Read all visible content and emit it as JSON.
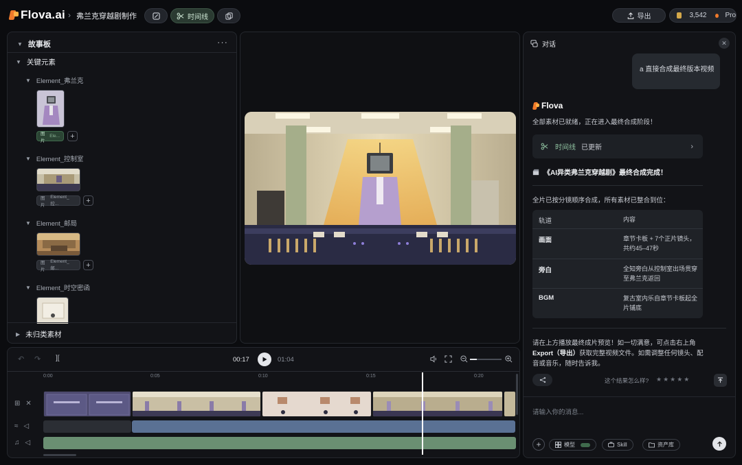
{
  "app": {
    "logo_text": "Flova.ai",
    "project_name": "弗兰克穿越剧制作",
    "crumb_sep": "›"
  },
  "toolbar": {
    "timeline_label": "时间线",
    "export_label": "导出",
    "credits": "3,542",
    "plan": "Pro"
  },
  "storyboard": {
    "title": "故事板",
    "more": "···",
    "key_elements_label": "关键元素",
    "elements": [
      {
        "name": "Element_弗兰克",
        "tag": "图片",
        "tag_sub": "Ele..."
      },
      {
        "name": "Element_控制室",
        "tag": "图片",
        "tag_sub": "Element_控..."
      },
      {
        "name": "Element_邮局",
        "tag": "图片",
        "tag_sub": "Element_邮..."
      },
      {
        "name": "Element_时空密函"
      }
    ],
    "uncategorized_label": "未归类素材"
  },
  "timeline": {
    "current_time": "00:17",
    "total_time": "01:04",
    "ticks": [
      "0:00",
      "0:05",
      "0:10",
      "0:15",
      "0:20"
    ],
    "playhead_progress": 0.8
  },
  "chat": {
    "title": "对话",
    "user_message": "a 直接合成最终版本视频",
    "brand": "Flova",
    "msg_ready": "全部素材已就绪，正在进入最终合成阶段！",
    "timeline_card_label": "时间线",
    "timeline_card_status": "已更新",
    "done_line": "《AI异类弗兰克穿越剧》最终合成完成！",
    "summary": "全片已按分镜顺序合成，所有素材已整合到位：",
    "table": {
      "headers": [
        "轨道",
        "内容"
      ],
      "rows": [
        {
          "track": "画面",
          "content": "章节卡板 + 7个正片镜头，共约45–47秒"
        },
        {
          "track": "旁白",
          "content": "全知旁白从控制室出场贯穿至弗兰克返回"
        },
        {
          "track": "BGM",
          "content": "复古室内乐自章节卡板起全片铺底"
        }
      ]
    },
    "closing_1": "请在上方播放最终成片预览！如一切满意，可点击右上角",
    "closing_bold": "Export（导出）",
    "closing_2": "获取完整视频文件。如需调整任何镜头、配音或音乐，随时告诉我。",
    "feedback_prompt": "这个结果怎么样?",
    "stars": "★★★★★",
    "input_placeholder": "请输入你的消息...",
    "chips": {
      "model": "模型",
      "skill": "Skill",
      "assets": "资产库"
    }
  },
  "colors": {
    "accent_orange": "#f07a2b",
    "accent_green": "#6a8f72",
    "accent_blue": "#5a7194"
  }
}
